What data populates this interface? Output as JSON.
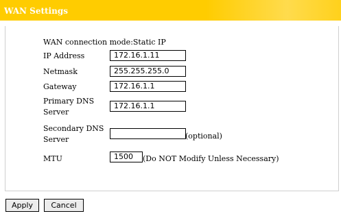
{
  "header": {
    "title": "WAN Settings",
    "color": "#ffcc00"
  },
  "form": {
    "mode_text": "WAN connection mode:Static IP",
    "ip_label": "IP Address",
    "ip_value": "172.16.1.11",
    "netmask_label": "Netmask",
    "netmask_value": "255.255.255.0",
    "gateway_label": "Gateway",
    "gateway_value": "172.16.1.1",
    "primary_dns_label": "Primary DNS Server",
    "primary_dns_value": "172.16.1.1",
    "secondary_dns_label": "Secondary DNS Server",
    "secondary_dns_value": "",
    "secondary_dns_hint": "(optional)",
    "mtu_label": "MTU",
    "mtu_value": "1500",
    "mtu_hint": "(Do NOT Modify Unless Necessary)"
  },
  "buttons": {
    "apply": "Apply",
    "cancel": "Cancel"
  }
}
